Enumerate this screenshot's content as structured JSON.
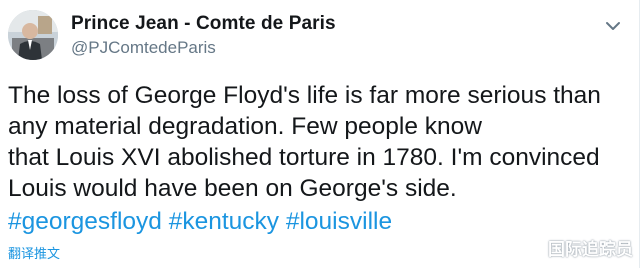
{
  "tweet": {
    "author": {
      "name": "Prince Jean - Comte de Paris",
      "handle": "@PJComtedeParis"
    },
    "text_lines": [
      "The loss of George Floyd's life is far more serious than",
      "any material degradation. Few people know",
      "that Louis XVI abolished torture in 1780. I'm convinced",
      "Louis would have been on George's side."
    ],
    "hashtags": [
      "#georgesfloyd",
      "#kentucky",
      "#louisville"
    ],
    "translate_label": "翻译推文"
  },
  "watermark": "国际追踪员",
  "colors": {
    "text": "#14171a",
    "secondary": "#657786",
    "link": "#1b95e0"
  },
  "icons": {
    "menu": "chevron-down-icon"
  }
}
